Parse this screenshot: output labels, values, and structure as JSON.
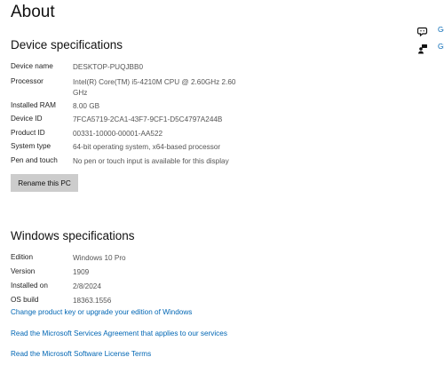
{
  "page": {
    "title": "About"
  },
  "device": {
    "heading": "Device specifications",
    "specs": [
      {
        "label": "Device name",
        "value": "DESKTOP-PUQJBB0"
      },
      {
        "label": "Processor",
        "value": "Intel(R) Core(TM) i5-4210M CPU @ 2.60GHz   2.60 GHz"
      },
      {
        "label": "Installed RAM",
        "value": "8.00 GB"
      },
      {
        "label": "Device ID",
        "value": "7FCA5719-2CA1-43F7-9CF1-D5C4797A244B"
      },
      {
        "label": "Product ID",
        "value": "00331-10000-00001-AA522"
      },
      {
        "label": "System type",
        "value": "64-bit operating system, x64-based processor"
      },
      {
        "label": "Pen and touch",
        "value": "No pen or touch input is available for this display"
      }
    ],
    "rename_button": "Rename this PC"
  },
  "windows": {
    "heading": "Windows specifications",
    "specs": [
      {
        "label": "Edition",
        "value": "Windows 10 Pro"
      },
      {
        "label": "Version",
        "value": "1909"
      },
      {
        "label": "Installed on",
        "value": "2/8/2024"
      },
      {
        "label": "OS build",
        "value": "18363.1556"
      }
    ],
    "links": [
      "Change product key or upgrade your edition of Windows",
      "Read the Microsoft Services Agreement that applies to our services",
      "Read the Microsoft Software License Terms"
    ]
  },
  "side_links": [
    {
      "icon": "chat-help-icon",
      "label": "Ge"
    },
    {
      "icon": "feedback-person-icon",
      "label": "Gi"
    }
  ],
  "colors": {
    "link": "#0066b4",
    "button": "#cccccc"
  }
}
